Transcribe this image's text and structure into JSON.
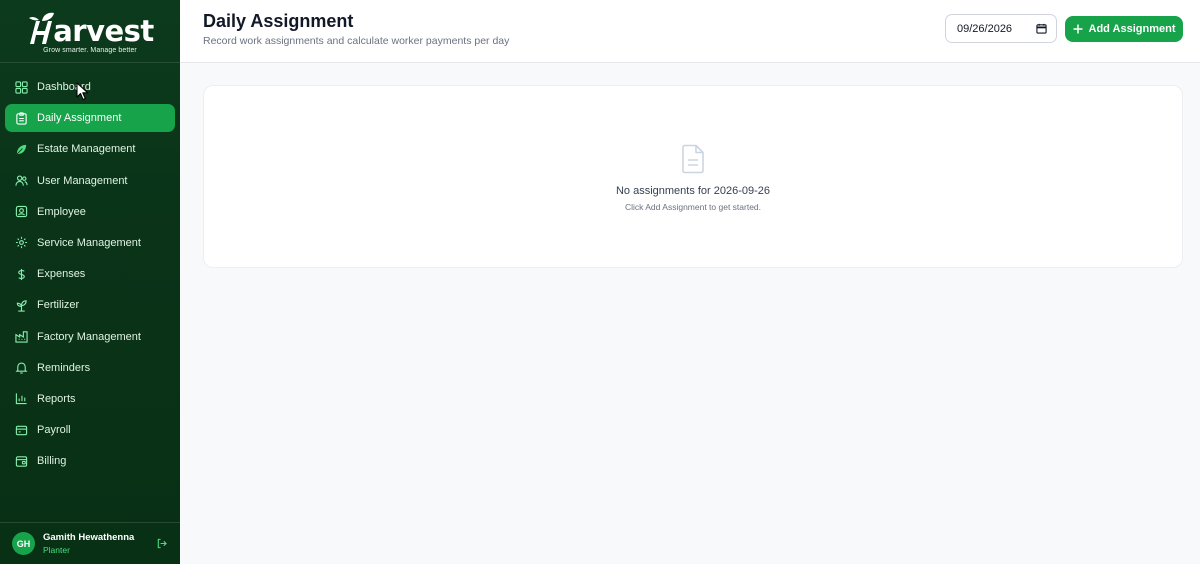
{
  "brand": {
    "name": "Harvest",
    "name_rest": "arvest",
    "tagline": "Grow smarter. Manage better"
  },
  "sidebar": {
    "items": [
      {
        "label": "Dashboard",
        "icon": "grid-icon"
      },
      {
        "label": "Daily Assignment",
        "icon": "clipboard-icon",
        "active": true
      },
      {
        "label": "Estate Management",
        "icon": "leaf-icon"
      },
      {
        "label": "User Management",
        "icon": "users-icon"
      },
      {
        "label": "Employee",
        "icon": "id-badge-icon"
      },
      {
        "label": "Service Management",
        "icon": "gear-icon"
      },
      {
        "label": "Expenses",
        "icon": "dollar-icon"
      },
      {
        "label": "Fertilizer",
        "icon": "sprout-icon"
      },
      {
        "label": "Factory Management",
        "icon": "factory-icon"
      },
      {
        "label": "Reminders",
        "icon": "bell-icon"
      },
      {
        "label": "Reports",
        "icon": "bar-chart-icon"
      },
      {
        "label": "Payroll",
        "icon": "wallet-icon"
      },
      {
        "label": "Billing",
        "icon": "receipt-icon"
      }
    ]
  },
  "user": {
    "initials": "GH",
    "name": "Gamith Hewathenna",
    "role": "Planter"
  },
  "header": {
    "title": "Daily Assignment",
    "subtitle": "Record work assignments and calculate worker payments per day",
    "date_value": "09/26/2026",
    "add_label": "Add Assignment"
  },
  "empty_state": {
    "title": "No assignments for 2026-09-26",
    "subtitle": "Click Add Assignment to get started."
  },
  "colors": {
    "accent": "#16a34a",
    "sidebar_bg": "#0a3318"
  }
}
